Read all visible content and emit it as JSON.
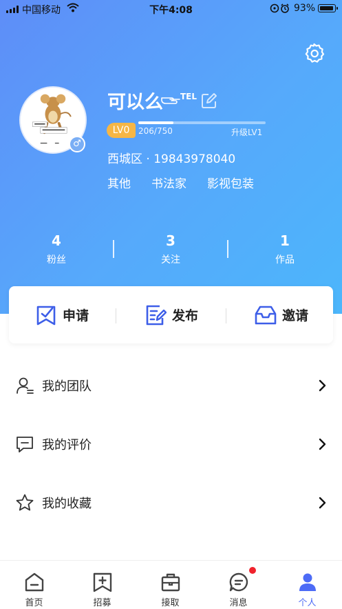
{
  "status_bar": {
    "carrier": "中国移动",
    "time": "下午4:08",
    "battery": "93%"
  },
  "profile": {
    "name": "可以么",
    "name_suffix": "TEL",
    "level_badge": "LV0",
    "level_progress_text": "206/750",
    "level_progress_fraction": 0.275,
    "next_level": "升级LV1",
    "location_line": "西城区 · 19843978040",
    "tags": [
      "其他",
      "书法家",
      "影视包装"
    ],
    "gender_symbol": "♂"
  },
  "stats": [
    {
      "value": "4",
      "label": "粉丝"
    },
    {
      "value": "3",
      "label": "关注"
    },
    {
      "value": "1",
      "label": "作品"
    }
  ],
  "actions": [
    {
      "label": "申请",
      "icon": "bookmark-check-icon"
    },
    {
      "label": "发布",
      "icon": "edit-document-icon"
    },
    {
      "label": "邀请",
      "icon": "inbox-icon"
    }
  ],
  "menu": [
    {
      "label": "我的团队",
      "icon": "team-icon"
    },
    {
      "label": "我的评价",
      "icon": "comment-icon"
    },
    {
      "label": "我的收藏",
      "icon": "star-icon"
    }
  ],
  "tabs": [
    {
      "label": "首页",
      "icon": "home-icon"
    },
    {
      "label": "招募",
      "icon": "recruit-icon"
    },
    {
      "label": "接取",
      "icon": "briefcase-icon"
    },
    {
      "label": "消息",
      "icon": "message-icon"
    },
    {
      "label": "个人",
      "icon": "person-icon",
      "active": true
    }
  ],
  "colors": {
    "accent": "#4d6bf6",
    "gradient_start": "#5e8df8",
    "gradient_end": "#4cb6fb",
    "level_badge": "#f6b645",
    "notification_dot": "#f0222c"
  }
}
